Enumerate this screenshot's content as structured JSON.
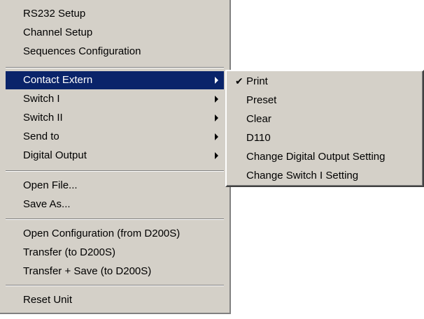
{
  "main_menu": {
    "items": [
      {
        "label": "RS232 Setup"
      },
      {
        "label": "Channel Setup"
      },
      {
        "label": "Sequences Configuration"
      },
      {
        "label": "Contact Extern"
      },
      {
        "label": "Switch I"
      },
      {
        "label": "Switch II"
      },
      {
        "label": "Send to"
      },
      {
        "label": "Digital Output"
      },
      {
        "label": "Open File..."
      },
      {
        "label": "Save As..."
      },
      {
        "label": "Open Configuration (from D200S)"
      },
      {
        "label": "Transfer (to D200S)"
      },
      {
        "label": "Transfer + Save (to D200S)"
      },
      {
        "label": "Reset Unit"
      }
    ]
  },
  "submenu": {
    "parent": "Contact Extern",
    "checked_item": "Print",
    "check_glyph": "✔",
    "items": [
      {
        "label": "Print"
      },
      {
        "label": "Preset"
      },
      {
        "label": "Clear"
      },
      {
        "label": "D110"
      },
      {
        "label": "Change Digital Output Setting"
      },
      {
        "label": "Change Switch I Setting"
      }
    ]
  },
  "colors": {
    "menu_bg": "#d4d0c8",
    "highlight_bg": "#0a246a",
    "highlight_text": "#ffffff"
  }
}
